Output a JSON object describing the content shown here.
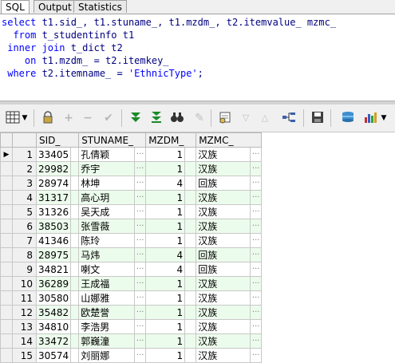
{
  "tabs": [
    {
      "label": "SQL",
      "active": true
    },
    {
      "label": "Output",
      "active": false
    },
    {
      "label": "Statistics",
      "active": false
    }
  ],
  "sql_lines": [
    [
      {
        "t": "kw",
        "v": "select"
      },
      {
        "t": "id",
        "v": " t1.sid_, t1.stuname_, t1.mzdm_, t2.itemvalue_ mzmc_"
      }
    ],
    [
      {
        "t": "kw",
        "v": "  from"
      },
      {
        "t": "id",
        "v": " t_studentinfo t1"
      }
    ],
    [
      {
        "t": "kw",
        "v": " inner join"
      },
      {
        "t": "id",
        "v": " t_dict t2"
      }
    ],
    [
      {
        "t": "kw",
        "v": "    on"
      },
      {
        "t": "id",
        "v": " t1.mzdm_ = t2.itemkey_"
      }
    ],
    [
      {
        "t": "kw",
        "v": " where"
      },
      {
        "t": "id",
        "v": " t2.itemname_ = "
      },
      {
        "t": "str",
        "v": "'EthnicType'"
      },
      {
        "t": "id",
        "v": ";"
      }
    ]
  ],
  "toolbar": [
    "grid-icon",
    "dropdown-icon",
    "lock-icon",
    "add-icon",
    "remove-icon",
    "post-icon",
    "first-icon",
    "last-icon",
    "find-icon",
    "clear-icon",
    "query-by-example-icon",
    "sort-asc-icon",
    "sort-desc-icon",
    "connect-icon",
    "save-icon",
    "export-icon",
    "chart-icon",
    "dropdown-icon"
  ],
  "columns": [
    "SID_",
    "STUNAME_",
    "MZDM_",
    "MZMC_"
  ],
  "rows": [
    {
      "n": "1",
      "sid": "33405",
      "name": "孔倩颖",
      "mzdm": "1",
      "mzmc": "汉族"
    },
    {
      "n": "2",
      "sid": "29982",
      "name": "乔宇",
      "mzdm": "1",
      "mzmc": "汉族"
    },
    {
      "n": "3",
      "sid": "28974",
      "name": "林坤",
      "mzdm": "4",
      "mzmc": "回族"
    },
    {
      "n": "4",
      "sid": "31317",
      "name": "高心玥",
      "mzdm": "1",
      "mzmc": "汉族"
    },
    {
      "n": "5",
      "sid": "31326",
      "name": "吴天成",
      "mzdm": "1",
      "mzmc": "汉族"
    },
    {
      "n": "6",
      "sid": "38503",
      "name": "张雪薇",
      "mzdm": "1",
      "mzmc": "汉族"
    },
    {
      "n": "7",
      "sid": "41346",
      "name": "陈玲",
      "mzdm": "1",
      "mzmc": "汉族"
    },
    {
      "n": "8",
      "sid": "28975",
      "name": "马炜",
      "mzdm": "4",
      "mzmc": "回族"
    },
    {
      "n": "9",
      "sid": "34821",
      "name": "喇文",
      "mzdm": "4",
      "mzmc": "回族"
    },
    {
      "n": "10",
      "sid": "36289",
      "name": "王成福",
      "mzdm": "1",
      "mzmc": "汉族"
    },
    {
      "n": "11",
      "sid": "30580",
      "name": "山娜雅",
      "mzdm": "1",
      "mzmc": "汉族"
    },
    {
      "n": "12",
      "sid": "35482",
      "name": "欧楚誉",
      "mzdm": "1",
      "mzmc": "汉族"
    },
    {
      "n": "13",
      "sid": "34810",
      "name": "李浩男",
      "mzdm": "1",
      "mzmc": "汉族"
    },
    {
      "n": "14",
      "sid": "33472",
      "name": "郭巍潼",
      "mzdm": "1",
      "mzmc": "汉族"
    },
    {
      "n": "15",
      "sid": "30574",
      "name": "刘丽娜",
      "mzdm": "1",
      "mzmc": "汉族"
    }
  ],
  "ellipsis": "···"
}
